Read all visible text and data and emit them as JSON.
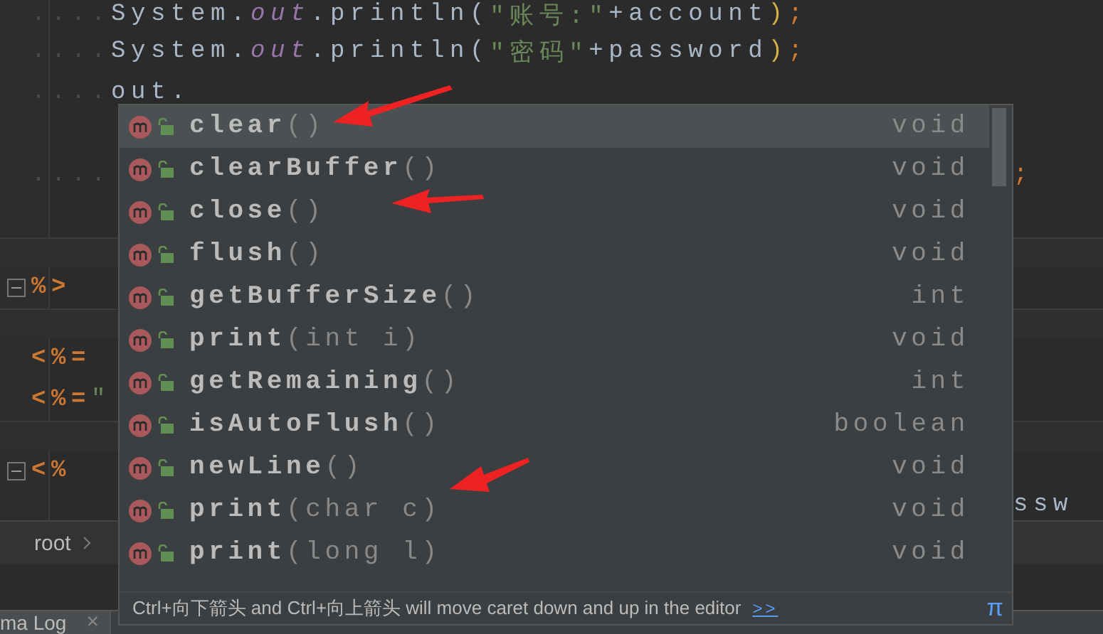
{
  "editor": {
    "lines": [
      {
        "kind": "code",
        "segments": [
          {
            "text": "....",
            "kind": "whitespace"
          },
          {
            "text": "System.",
            "kind": "plain"
          },
          {
            "text": "out",
            "kind": "field"
          },
          {
            "text": ".println(",
            "kind": "plain"
          },
          {
            "text": "\"账号:\"",
            "kind": "string"
          },
          {
            "text": "+account",
            "kind": "plain"
          },
          {
            "text": ")",
            "kind": "paren"
          },
          {
            "text": ";",
            "kind": "punct"
          }
        ]
      },
      {
        "kind": "code",
        "segments": [
          {
            "text": "....",
            "kind": "whitespace"
          },
          {
            "text": "System.",
            "kind": "plain"
          },
          {
            "text": "out",
            "kind": "field"
          },
          {
            "text": ".println(",
            "kind": "plain"
          },
          {
            "text": "\"密码\"",
            "kind": "string"
          },
          {
            "text": "+password",
            "kind": "plain"
          },
          {
            "text": ")",
            "kind": "paren"
          },
          {
            "text": ";",
            "kind": "punct"
          }
        ]
      },
      {
        "kind": "code",
        "segments": [
          {
            "text": "....",
            "kind": "whitespace"
          },
          {
            "text": "out.",
            "kind": "plain"
          }
        ]
      },
      {
        "kind": "blank"
      },
      {
        "kind": "code",
        "segments": [
          {
            "text": "....",
            "kind": "whitespace"
          }
        ],
        "tail": ";"
      },
      {
        "kind": "blank"
      },
      {
        "kind": "break"
      },
      {
        "kind": "code",
        "segments": [
          {
            "text": "%>",
            "kind": "tag"
          }
        ],
        "fold": true
      },
      {
        "kind": "break"
      },
      {
        "kind": "code",
        "segments": [
          {
            "text": "<%=",
            "kind": "tag"
          }
        ],
        "fold": false
      },
      {
        "kind": "code",
        "segments": [
          {
            "text": "<%=",
            "kind": "tag"
          },
          {
            "text": "\"",
            "kind": "string"
          }
        ],
        "fold": false
      },
      {
        "kind": "break"
      },
      {
        "kind": "code",
        "segments": [
          {
            "text": "<%",
            "kind": "tag"
          }
        ],
        "fold": true
      },
      {
        "kind": "code",
        "tail": "ssw"
      }
    ]
  },
  "completion": {
    "items": [
      {
        "name": "clear",
        "params": "()",
        "type": "void",
        "selected": true
      },
      {
        "name": "clearBuffer",
        "params": "()",
        "type": "void",
        "selected": false
      },
      {
        "name": "close",
        "params": "()",
        "type": "void",
        "selected": false
      },
      {
        "name": "flush",
        "params": "()",
        "type": "void",
        "selected": false
      },
      {
        "name": "getBufferSize",
        "params": "()",
        "type": "int",
        "selected": false
      },
      {
        "name": "print",
        "params": "(int i)",
        "type": "void",
        "selected": false
      },
      {
        "name": "getRemaining",
        "params": "()",
        "type": "int",
        "selected": false
      },
      {
        "name": "isAutoFlush",
        "params": "()",
        "type": "boolean",
        "selected": false
      },
      {
        "name": "newLine",
        "params": "()",
        "type": "void",
        "selected": false
      },
      {
        "name": "print",
        "params": "(char c)",
        "type": "void",
        "selected": false
      },
      {
        "name": "print",
        "params": "(long l)",
        "type": "void",
        "selected": false
      }
    ],
    "hint": "Ctrl+向下箭头 and Ctrl+向上箭头 will move caret down and up in the editor",
    "hint_link": ">>",
    "pi": "π"
  },
  "breadcrumb": {
    "items": [
      "root"
    ]
  },
  "bottom_tab": {
    "label": "ma Log",
    "close": "×"
  }
}
